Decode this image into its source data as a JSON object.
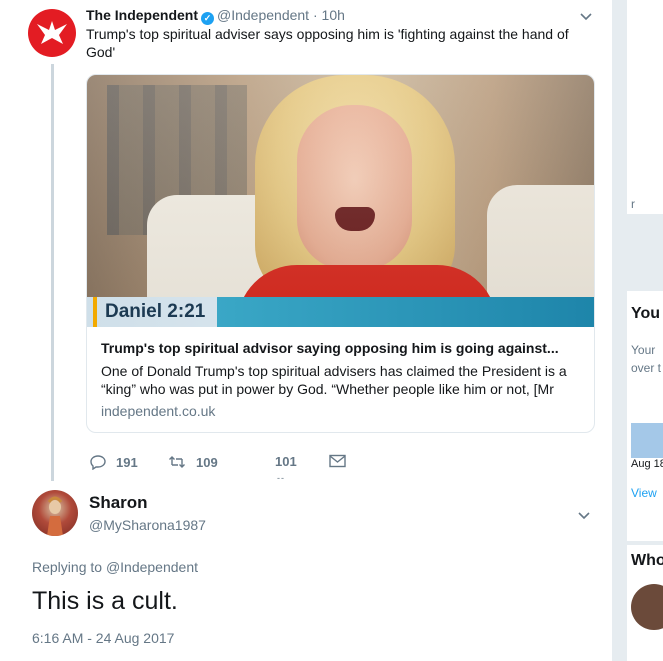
{
  "sidebar": {
    "top_text": "r",
    "who_heading_partial": "You",
    "line1": "Your",
    "line2": "over t",
    "date_partial": "Aug 18",
    "view_partial": "View",
    "who_to_follow_partial": "Who"
  },
  "tweet1": {
    "name": "The Independent",
    "handle": "@Independent",
    "separator": "·",
    "time": "10h",
    "text": "Trump's top spiritual adviser says opposing him is 'fighting against the hand of God'",
    "card": {
      "image_label": "Daniel 2:21",
      "title": "Trump's top spiritual advisor saying opposing him is going against...",
      "description": "One of Donald Trump's top spiritual advisers has claimed the President is a “king” who was put in power by God. “Whether people like him or not, [Mr",
      "domain": "independent.co.uk"
    },
    "actions": {
      "replies": "191",
      "retweets": "109",
      "likes": "101",
      "likes_overflow": "--"
    }
  },
  "tweet2": {
    "name": "Sharon",
    "handle": "@MySharona1987",
    "replying_prefix": "Replying to",
    "replying_to": "@Independent",
    "text": "This is a cult.",
    "timestamp": "6:16 AM - 24 Aug 2017"
  },
  "colors": {
    "accent": "#1da1f2",
    "muted": "#657786",
    "brand_red": "#e31c23"
  }
}
